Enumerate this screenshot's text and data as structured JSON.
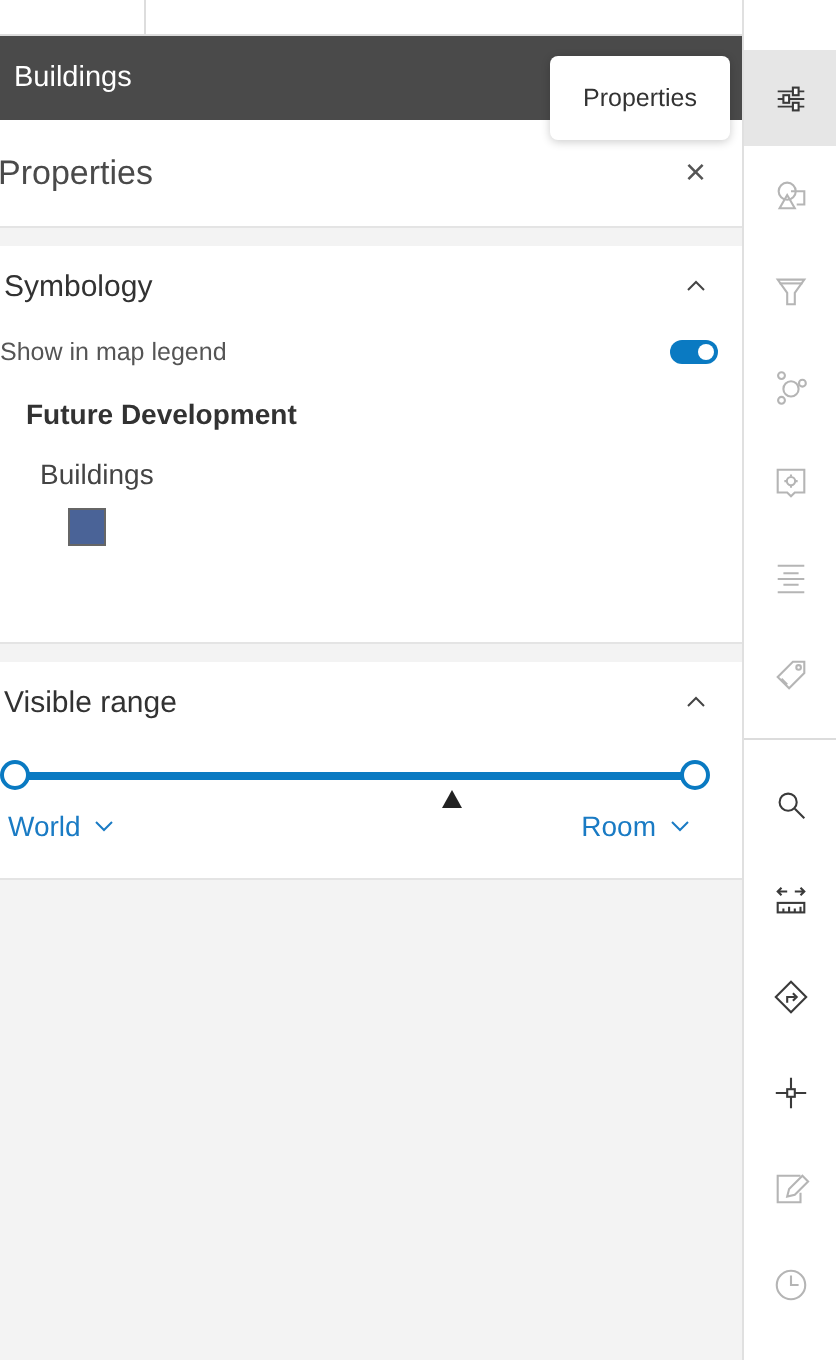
{
  "layer_bar": {
    "title": "Buildings"
  },
  "tooltip": {
    "text": "Properties"
  },
  "panel": {
    "title": "Properties",
    "close": "×"
  },
  "symbology": {
    "title": "Symbology",
    "expanded": true,
    "legend_toggle": {
      "label": "Show in map legend",
      "on": true
    },
    "group": "Future Development",
    "legend_items": [
      {
        "label": "Buildings",
        "color": "#4a6397"
      }
    ]
  },
  "visible_range": {
    "title": "Visible range",
    "expanded": true,
    "min_thumb": {
      "level": 0
    },
    "max_thumb": {
      "level": 1
    },
    "current_scale": {
      "level": 0.64
    },
    "min_label": "World",
    "max_label": "Room"
  },
  "toolbar": [
    {
      "kind": "properties",
      "selected": true,
      "disabled": false
    },
    {
      "kind": "shapes",
      "selected": false,
      "disabled": true
    },
    {
      "kind": "filter",
      "selected": false,
      "disabled": true
    },
    {
      "kind": "cluster",
      "selected": false,
      "disabled": true
    },
    {
      "kind": "popup",
      "selected": false,
      "disabled": true
    },
    {
      "kind": "align",
      "selected": false,
      "disabled": true
    },
    {
      "kind": "label",
      "selected": false,
      "disabled": true
    },
    {
      "kind": "search",
      "selected": false,
      "disabled": false,
      "divider_before": true
    },
    {
      "kind": "measure",
      "selected": false,
      "disabled": false
    },
    {
      "kind": "directions",
      "selected": false,
      "disabled": false
    },
    {
      "kind": "crosshair",
      "selected": false,
      "disabled": false
    },
    {
      "kind": "edit",
      "selected": false,
      "disabled": true
    },
    {
      "kind": "clock",
      "selected": false,
      "disabled": true
    }
  ]
}
